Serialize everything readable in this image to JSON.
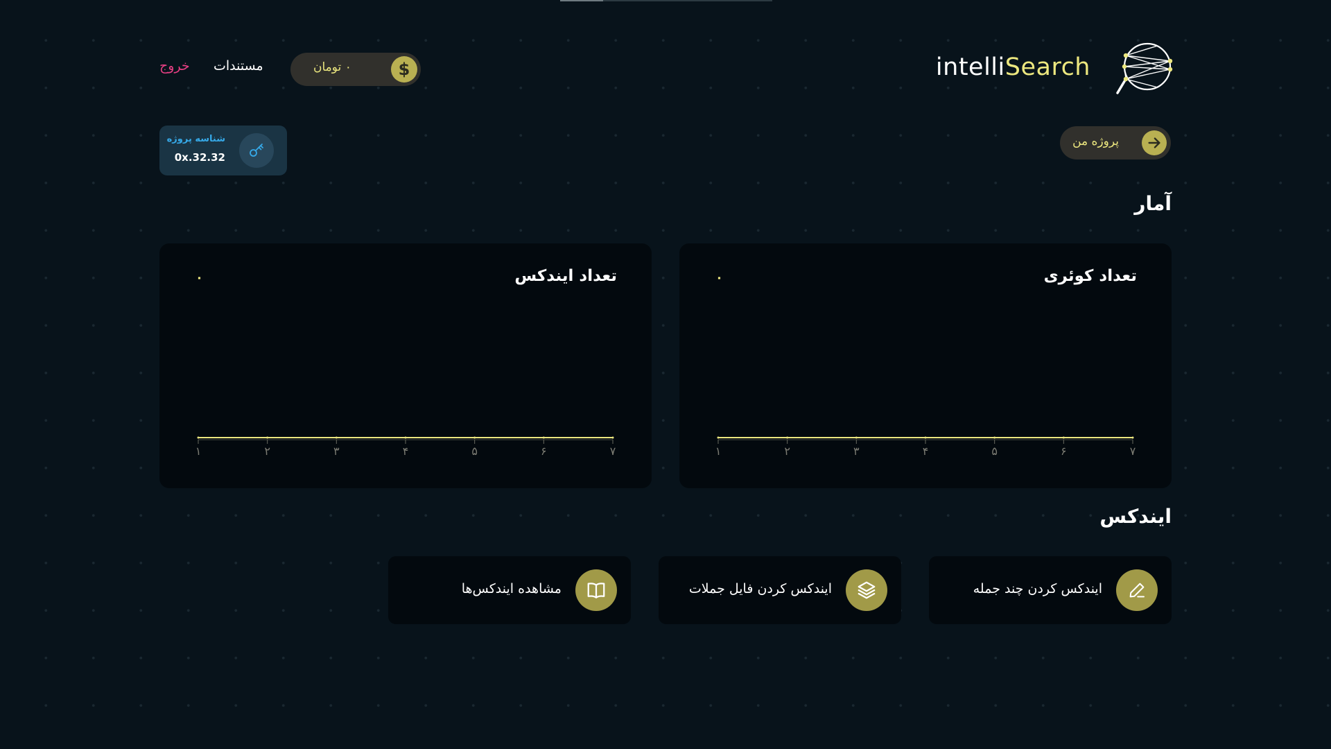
{
  "header": {
    "brand_part1": "intelli",
    "brand_part2": "Search",
    "balance": "۰ تومان",
    "docs_label": "مستندات",
    "logout_label": "خروج"
  },
  "project": {
    "id_label": "شناسه پروژه",
    "id_value": "0x.32.32",
    "my_project_label": "پروژه من"
  },
  "stats": {
    "title": "آمار",
    "cards": [
      {
        "title": "تعداد کوئری",
        "value": "۰"
      },
      {
        "title": "تعداد ایندکس",
        "value": "۰"
      }
    ]
  },
  "chart_data": [
    {
      "type": "line",
      "title": "تعداد کوئری",
      "x": [
        "۱",
        "۲",
        "۳",
        "۴",
        "۵",
        "۶",
        "۷"
      ],
      "series": [
        {
          "values": [
            0,
            0,
            0,
            0,
            0,
            0,
            0
          ]
        }
      ]
    },
    {
      "type": "line",
      "title": "تعداد ایندکس",
      "x": [
        "۱",
        "۲",
        "۳",
        "۴",
        "۵",
        "۶",
        "۷"
      ],
      "series": [
        {
          "values": [
            0,
            0,
            0,
            0,
            0,
            0,
            0
          ]
        }
      ]
    }
  ],
  "index": {
    "title": "ایندکس",
    "actions": [
      {
        "label": "ایندکس کردن چند جمله",
        "icon": "pencil-icon"
      },
      {
        "label": "ایندکس کردن فایل جملات",
        "icon": "layers-icon"
      },
      {
        "label": "مشاهده ایندکس‌ها",
        "icon": "book-icon"
      }
    ]
  },
  "colors": {
    "background": "#08131b",
    "accent": "#ece77f",
    "accent_button": "#b9b052",
    "logout": "#e63f83",
    "project_id_label": "#36a9e8"
  }
}
